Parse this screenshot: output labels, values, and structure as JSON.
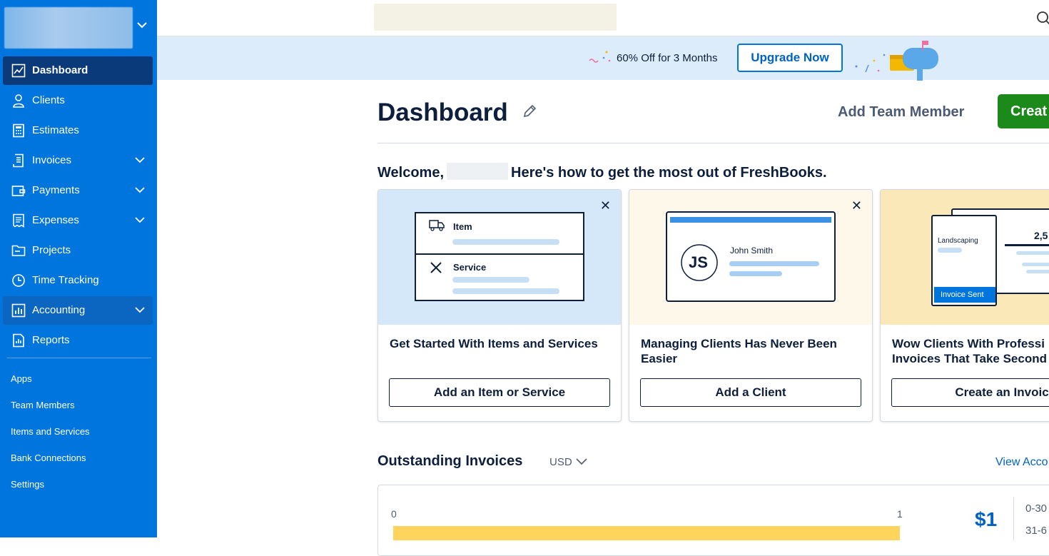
{
  "sidebar": {
    "items": [
      {
        "label": "Dashboard",
        "icon": "chart-line-icon",
        "active": true,
        "has_chevron": false
      },
      {
        "label": "Clients",
        "icon": "person-icon",
        "active": false,
        "has_chevron": false
      },
      {
        "label": "Estimates",
        "icon": "calculator-icon",
        "active": false,
        "has_chevron": false
      },
      {
        "label": "Invoices",
        "icon": "invoice-icon",
        "active": false,
        "has_chevron": true
      },
      {
        "label": "Payments",
        "icon": "wallet-icon",
        "active": false,
        "has_chevron": true
      },
      {
        "label": "Expenses",
        "icon": "receipt-icon",
        "active": false,
        "has_chevron": true
      },
      {
        "label": "Projects",
        "icon": "folder-icon",
        "active": false,
        "has_chevron": false
      },
      {
        "label": "Time Tracking",
        "icon": "clock-icon",
        "active": false,
        "has_chevron": false
      },
      {
        "label": "Accounting",
        "icon": "bar-chart-icon",
        "active": false,
        "has_chevron": true
      },
      {
        "label": "Reports",
        "icon": "report-icon",
        "active": false,
        "has_chevron": false
      }
    ],
    "links": [
      "Apps",
      "Team Members",
      "Items and Services",
      "Bank Connections",
      "Settings"
    ]
  },
  "promo": {
    "text": "60% Off for 3 Months",
    "button": "Upgrade Now"
  },
  "header": {
    "title": "Dashboard",
    "add_team": "Add Team Member",
    "create": "Creat"
  },
  "welcome": {
    "prefix": "Welcome,",
    "suffix": "Here's how to get the most out of FreshBooks."
  },
  "cards": [
    {
      "title": "Get Started With Items and Services",
      "button": "Add an Item or Service",
      "art": {
        "row1": "Item",
        "row2": "Service"
      }
    },
    {
      "title": "Managing Clients Has Never Been Easier",
      "button": "Add a Client",
      "art": {
        "initials": "JS",
        "name": "John Smith"
      }
    },
    {
      "title": "Wow Clients With Professi Invoices That Take Second",
      "button": "Create an Invoic",
      "art": {
        "label": "Landscaping",
        "amount": "2,5",
        "badge": "Invoice Sent"
      }
    }
  ],
  "outstanding": {
    "title": "Outstanding Invoices",
    "currency": "USD",
    "view_link": "View Acco",
    "axis_min": "0",
    "axis_max": "1",
    "bar_fill": 1.0,
    "amount": "$1",
    "ranges": [
      "0-30",
      "31-6"
    ]
  },
  "colors": {
    "sidebar": "#0075dd",
    "active": "#0b3a7a",
    "accent": "#0063c4",
    "create": "#1b8a1b",
    "bar": "#ffd45c"
  }
}
